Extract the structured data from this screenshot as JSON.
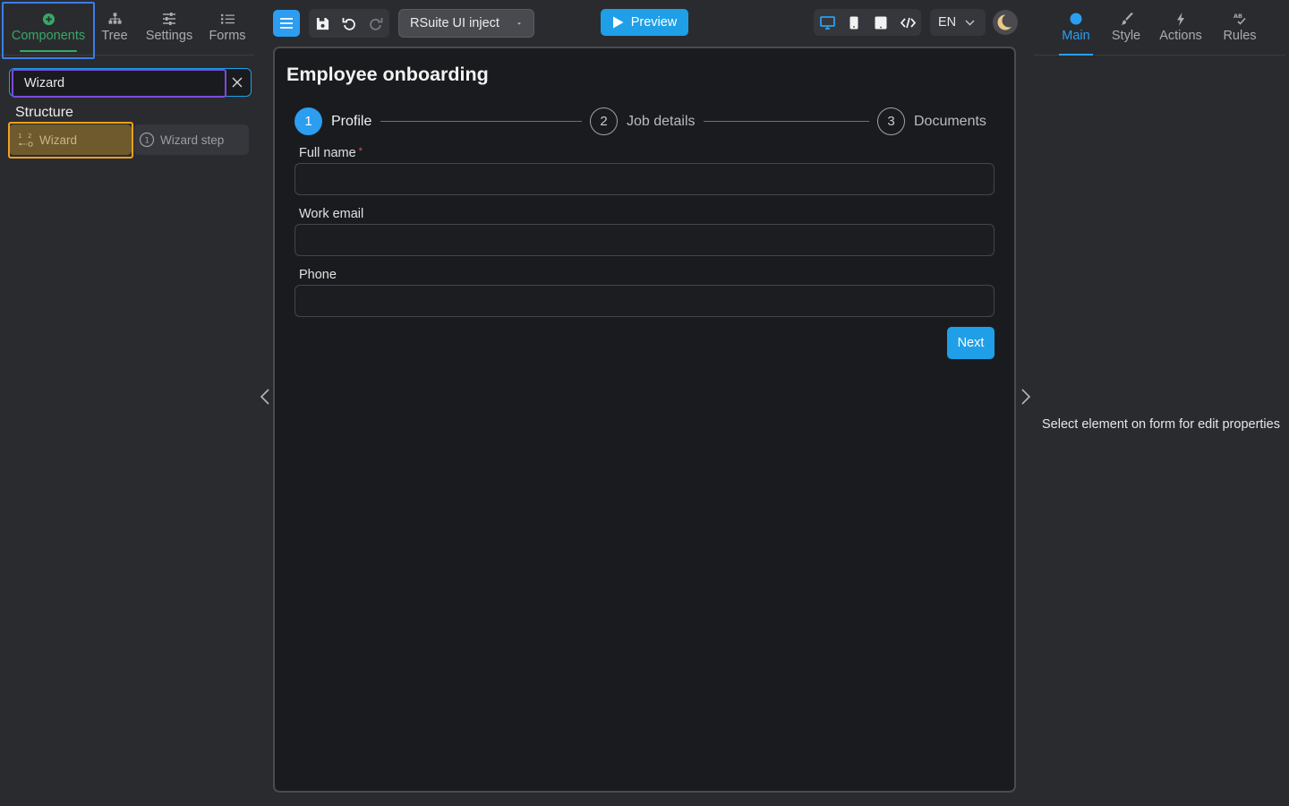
{
  "left_panel": {
    "tabs": [
      {
        "label": "Components",
        "icon": "plus-circle-icon",
        "active": true
      },
      {
        "label": "Tree",
        "icon": "tree-icon"
      },
      {
        "label": "Settings",
        "icon": "sliders-icon"
      },
      {
        "label": "Forms",
        "icon": "list-icon"
      }
    ],
    "search": {
      "value": "Wizard"
    },
    "section_title": "Structure",
    "components": [
      {
        "label": "Wizard",
        "icon": "wizard-steps-icon"
      },
      {
        "label": "Wizard step",
        "icon": "step-number-icon"
      }
    ]
  },
  "toolbar": {
    "theme_select": "RSuite UI inject",
    "preview_label": "Preview",
    "language": "EN"
  },
  "form": {
    "title": "Employee onboarding",
    "steps": [
      {
        "number": "1",
        "label": "Profile",
        "active": true
      },
      {
        "number": "2",
        "label": "Job details"
      },
      {
        "number": "3",
        "label": "Documents"
      }
    ],
    "fields": [
      {
        "label": "Full name",
        "required_mark": "*"
      },
      {
        "label": "Work email"
      },
      {
        "label": "Phone"
      }
    ],
    "next_label": "Next"
  },
  "right_panel": {
    "tabs": [
      {
        "label": "Main",
        "icon": "dot-icon",
        "active": true
      },
      {
        "label": "Style",
        "icon": "brush-icon"
      },
      {
        "label": "Actions",
        "icon": "lightning-icon"
      },
      {
        "label": "Rules",
        "icon": "rules-icon"
      }
    ],
    "empty_message": "Select element on form for edit properties"
  },
  "colors": {
    "accent_blue": "#1e9fe8",
    "accent_green": "#38a867",
    "canvas_bg": "#1a1b1f",
    "panel_bg": "#2a2b2f"
  }
}
